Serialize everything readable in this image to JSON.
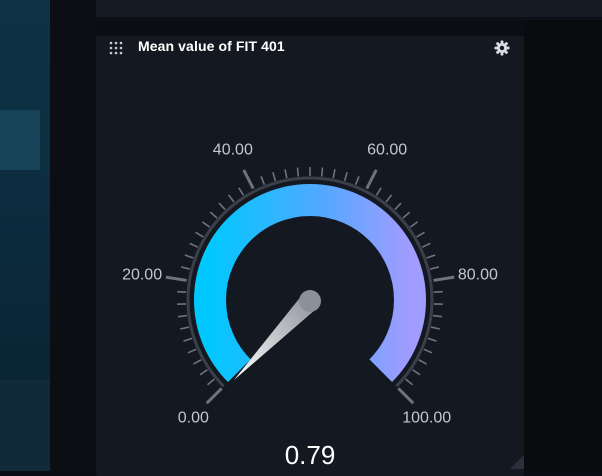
{
  "widget": {
    "title": "Mean value of FIT 401",
    "value": "0.79",
    "icons": {
      "drag": "drag-grid-icon",
      "settings": "gear-icon"
    }
  },
  "gauge": {
    "min": 0,
    "max": 100,
    "current": 0.79,
    "major_labels": [
      "0.00",
      "20.00",
      "40.00",
      "60.00",
      "80.00",
      "100.00"
    ],
    "colors": {
      "start": "#00c8ff",
      "mid": "#52a8ff",
      "end": "#a19cff",
      "track": "#3b3f4a",
      "ticks": "#6f7380"
    }
  }
}
